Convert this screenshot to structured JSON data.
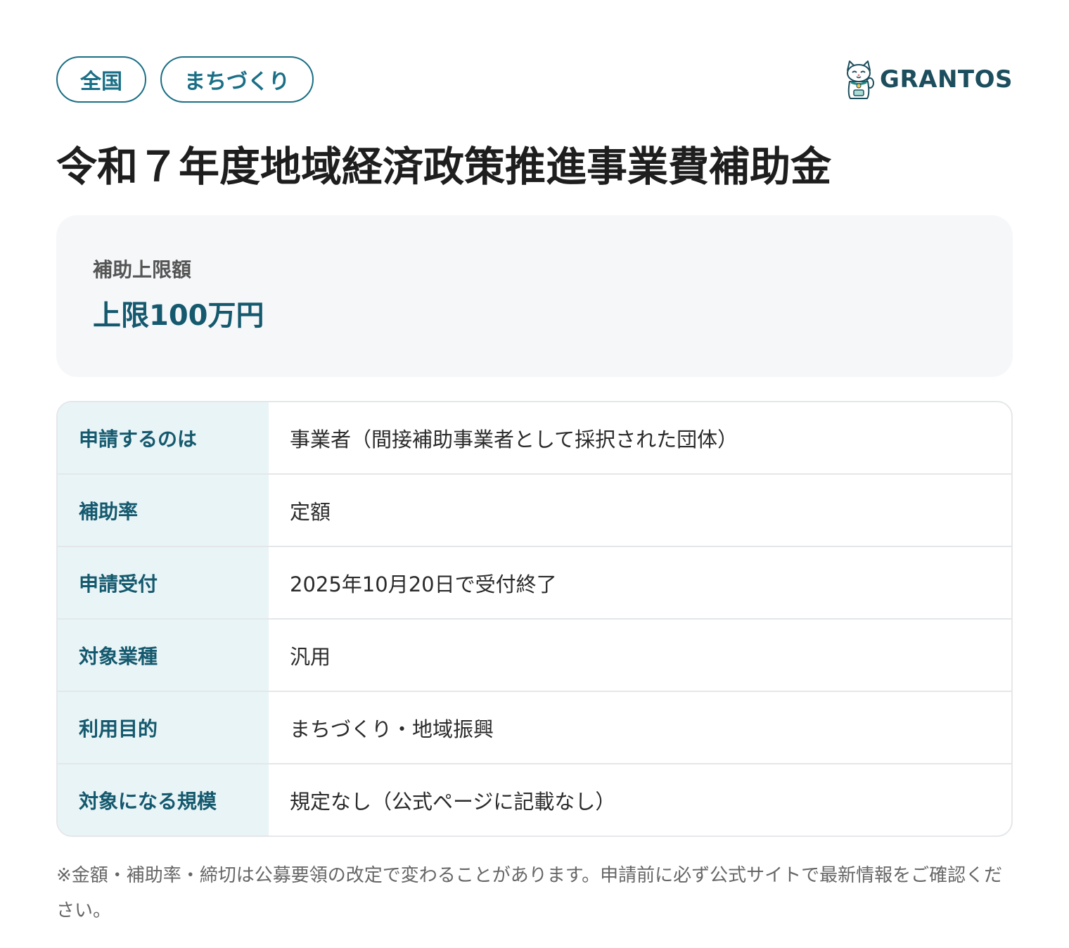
{
  "tags": [
    "全国",
    "まちづくり"
  ],
  "brand": {
    "name": "GRANTOS",
    "icon": "lucky-cat-icon",
    "color": "#1d4e5e"
  },
  "title": "令和７年度地域経済政策推進事業費補助金",
  "amount": {
    "label": "補助上限額",
    "value": "上限100万円"
  },
  "details": [
    {
      "key": "申請するのは",
      "value": "事業者（間接補助事業者として採択された団体）"
    },
    {
      "key": "補助率",
      "value": "定額"
    },
    {
      "key": "申請受付",
      "value": "2025年10月20日で受付終了"
    },
    {
      "key": "対象業種",
      "value": "汎用"
    },
    {
      "key": "利用目的",
      "value": "まちづくり・地域振興"
    },
    {
      "key": "対象になる規模",
      "value": "規定なし（公式ページに記載なし）"
    }
  ],
  "note": "※金額・補助率・締切は公募要領の改定で変わることがあります。申請前に必ず公式サイトで最新情報をご確認ください。",
  "colors": {
    "accent": "#1a6f86",
    "key_background": "#e9f4f6",
    "card_background": "#f5f7f9"
  }
}
